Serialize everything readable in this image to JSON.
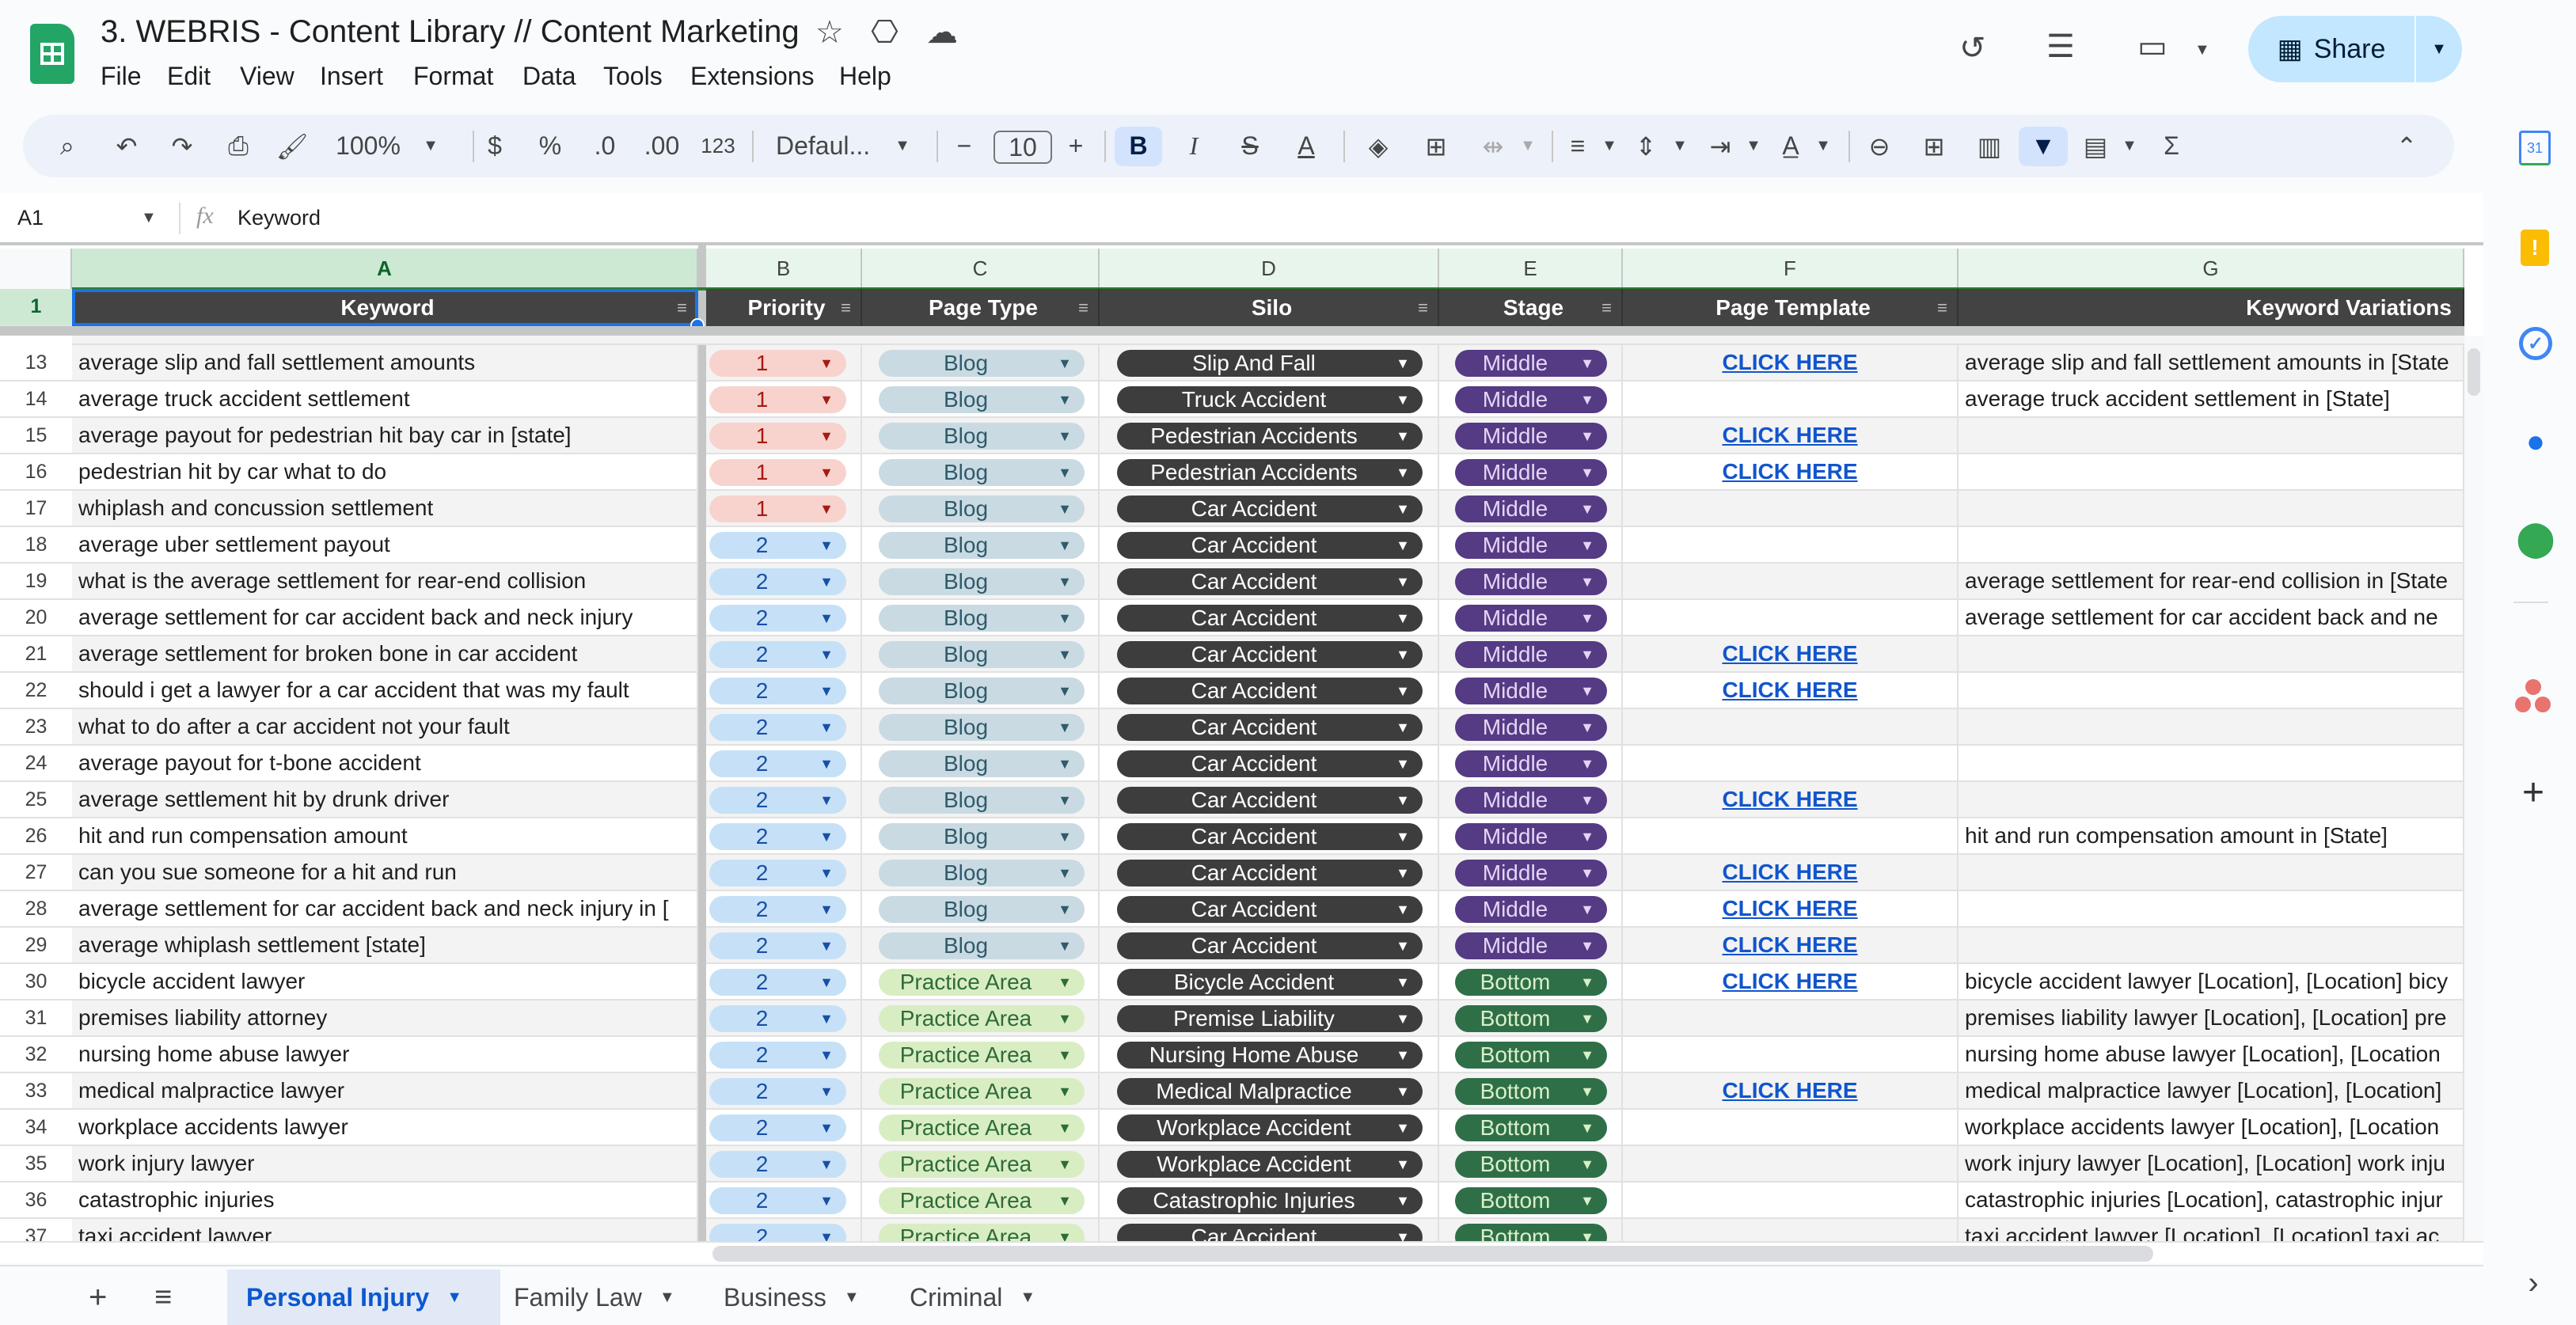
{
  "app": {
    "title": "3. WEBRIS - Content Library // Content Marketing",
    "menu": [
      "File",
      "Edit",
      "View",
      "Insert",
      "Format",
      "Data",
      "Tools",
      "Extensions",
      "Help"
    ],
    "share_label": "Share"
  },
  "toolbar": {
    "zoom": "100%",
    "currency": "$",
    "percent": "%",
    "dec_decrease": ".0",
    "dec_increase": ".00",
    "number_format": "123",
    "font": "Defaul...",
    "font_size": "10",
    "bold": "B",
    "italic": "I",
    "text_color": "A",
    "sum": "Σ"
  },
  "formula_bar": {
    "cell_ref": "A1",
    "content": "Keyword"
  },
  "columns": [
    "A",
    "B",
    "C",
    "D",
    "E",
    "F",
    "G"
  ],
  "header_row": {
    "number": "1",
    "cells": [
      "Keyword",
      "Priority",
      "Page Type",
      "Silo",
      "Stage",
      "Page Template",
      "Keyword Variations"
    ]
  },
  "rows": [
    {
      "n": "13",
      "k": "average slip and fall settlement amounts",
      "p": "1",
      "t": "Blog",
      "s": "Slip And Fall",
      "st": "Middle",
      "f": "CLICK HERE",
      "v": "average slip and fall settlement amounts in [State"
    },
    {
      "n": "14",
      "k": "average truck accident settlement",
      "p": "1",
      "t": "Blog",
      "s": "Truck Accident",
      "st": "Middle",
      "f": "",
      "v": "average truck accident settlement in [State]"
    },
    {
      "n": "15",
      "k": "average payout for pedestrian hit bay car in [state]",
      "p": "1",
      "t": "Blog",
      "s": "Pedestrian Accidents",
      "st": "Middle",
      "f": "CLICK HERE",
      "v": ""
    },
    {
      "n": "16",
      "k": "pedestrian hit by car what to do",
      "p": "1",
      "t": "Blog",
      "s": "Pedestrian Accidents",
      "st": "Middle",
      "f": "CLICK HERE",
      "v": ""
    },
    {
      "n": "17",
      "k": "whiplash and concussion settlement",
      "p": "1",
      "t": "Blog",
      "s": "Car Accident",
      "st": "Middle",
      "f": "",
      "v": ""
    },
    {
      "n": "18",
      "k": "average uber settlement payout",
      "p": "2",
      "t": "Blog",
      "s": "Car Accident",
      "st": "Middle",
      "f": "",
      "v": ""
    },
    {
      "n": "19",
      "k": "what is the average settlement for rear-end collision",
      "p": "2",
      "t": "Blog",
      "s": "Car Accident",
      "st": "Middle",
      "f": "",
      "v": "average settlement for rear-end collision in [State"
    },
    {
      "n": "20",
      "k": "average settlement for car accident back and neck injury",
      "p": "2",
      "t": "Blog",
      "s": "Car Accident",
      "st": "Middle",
      "f": "",
      "v": "average settlement for car accident back and ne"
    },
    {
      "n": "21",
      "k": "average settlement for broken bone in car accident",
      "p": "2",
      "t": "Blog",
      "s": "Car Accident",
      "st": "Middle",
      "f": "CLICK HERE",
      "v": ""
    },
    {
      "n": "22",
      "k": "should i get a lawyer for a car accident that was my fault",
      "p": "2",
      "t": "Blog",
      "s": "Car Accident",
      "st": "Middle",
      "f": "CLICK HERE",
      "v": ""
    },
    {
      "n": "23",
      "k": "what to do after a car accident not your fault",
      "p": "2",
      "t": "Blog",
      "s": "Car Accident",
      "st": "Middle",
      "f": "",
      "v": ""
    },
    {
      "n": "24",
      "k": "average payout for t-bone accident",
      "p": "2",
      "t": "Blog",
      "s": "Car Accident",
      "st": "Middle",
      "f": "",
      "v": ""
    },
    {
      "n": "25",
      "k": "average settlement hit by drunk driver",
      "p": "2",
      "t": "Blog",
      "s": "Car Accident",
      "st": "Middle",
      "f": "CLICK HERE",
      "v": ""
    },
    {
      "n": "26",
      "k": "hit and run compensation amount",
      "p": "2",
      "t": "Blog",
      "s": "Car Accident",
      "st": "Middle",
      "f": "",
      "v": "hit and run compensation amount in [State]"
    },
    {
      "n": "27",
      "k": "can you sue someone for a hit and run",
      "p": "2",
      "t": "Blog",
      "s": "Car Accident",
      "st": "Middle",
      "f": "CLICK HERE",
      "v": ""
    },
    {
      "n": "28",
      "k": "average settlement for car accident back and neck injury in [",
      "p": "2",
      "t": "Blog",
      "s": "Car Accident",
      "st": "Middle",
      "f": "CLICK HERE",
      "v": ""
    },
    {
      "n": "29",
      "k": "average whiplash settlement [state]",
      "p": "2",
      "t": "Blog",
      "s": "Car Accident",
      "st": "Middle",
      "f": "CLICK HERE",
      "v": ""
    },
    {
      "n": "30",
      "k": "bicycle accident lawyer",
      "p": "2",
      "t": "Practice Area",
      "s": "Bicycle Accident",
      "st": "Bottom",
      "f": "CLICK HERE",
      "v": "bicycle accident lawyer [Location], [Location] bicy"
    },
    {
      "n": "31",
      "k": "premises liability attorney",
      "p": "2",
      "t": "Practice Area",
      "s": "Premise Liability",
      "st": "Bottom",
      "f": "",
      "v": "premises liability lawyer [Location], [Location] pre"
    },
    {
      "n": "32",
      "k": "nursing home abuse lawyer",
      "p": "2",
      "t": "Practice Area",
      "s": "Nursing Home Abuse",
      "st": "Bottom",
      "f": "",
      "v": "nursing home abuse lawyer [Location], [Location"
    },
    {
      "n": "33",
      "k": "medical malpractice lawyer",
      "p": "2",
      "t": "Practice Area",
      "s": "Medical Malpractice",
      "st": "Bottom",
      "f": "CLICK HERE",
      "v": "medical malpractice lawyer [Location], [Location]"
    },
    {
      "n": "34",
      "k": "workplace accidents lawyer",
      "p": "2",
      "t": "Practice Area",
      "s": "Workplace Accident",
      "st": "Bottom",
      "f": "",
      "v": "workplace accidents lawyer [Location], [Location"
    },
    {
      "n": "35",
      "k": "work injury lawyer",
      "p": "2",
      "t": "Practice Area",
      "s": "Workplace Accident",
      "st": "Bottom",
      "f": "",
      "v": "work injury lawyer [Location], [Location] work inju"
    },
    {
      "n": "36",
      "k": "catastrophic injuries",
      "p": "2",
      "t": "Practice Area",
      "s": "Catastrophic Injuries",
      "st": "Bottom",
      "f": "",
      "v": "catastrophic injuries [Location], catastrophic injur"
    },
    {
      "n": "37",
      "k": "taxi accident lawyer",
      "p": "2",
      "t": "Practice Area",
      "s": "Car Accident",
      "st": "Bottom",
      "f": "",
      "v": "taxi accident lawyer [Location], [Location] taxi ac"
    }
  ],
  "sheet_tabs": [
    {
      "label": "Personal Injury",
      "active": true
    },
    {
      "label": "Family Law"
    },
    {
      "label": "Business"
    },
    {
      "label": "Criminal"
    }
  ],
  "colors": {
    "priority_1_bg": "#f8d3ce",
    "priority_1_fg": "#a61b13",
    "priority_2_bg": "#c6e1f7",
    "priority_2_fg": "#1a4fa8",
    "blog_bg": "#c9dae2",
    "blog_fg": "#2f5b6b",
    "practice_bg": "#d9edc3",
    "practice_fg": "#2e6b3a",
    "silo_bg": "#3d3d3d",
    "middle_bg": "#553a84",
    "middle_fg": "#e3d6f5",
    "bottom_bg": "#2f6f48",
    "bottom_fg": "#d9f0c8",
    "header_bg": "#434343",
    "accent": "#0b57d0"
  }
}
